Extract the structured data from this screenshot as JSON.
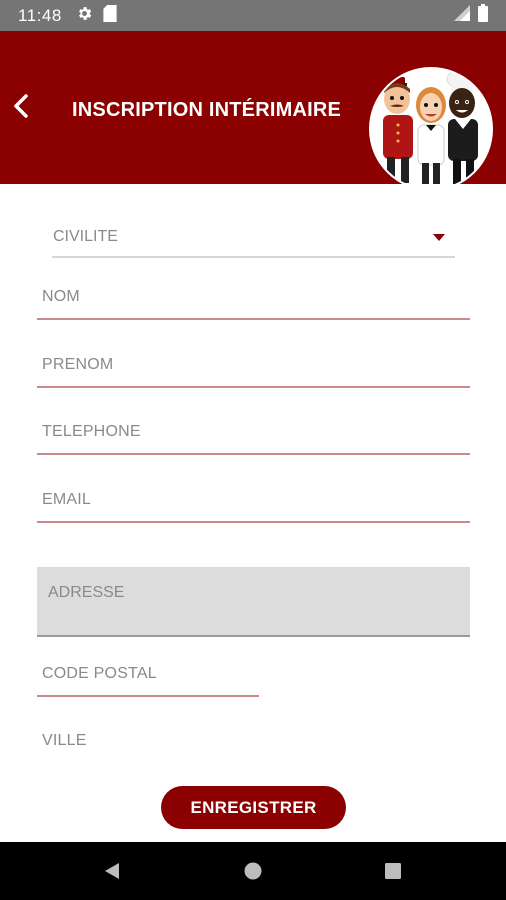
{
  "status_bar": {
    "time": "11:48",
    "icons": [
      "gear-icon",
      "sd-card-icon",
      "signal-icon",
      "battery-icon"
    ]
  },
  "app_bar": {
    "title": "INSCRIPTION INTÉRIMAIRE",
    "back_icon": "chevron-left-icon",
    "image": "mascots-illustration"
  },
  "form": {
    "civilite": {
      "label": "CIVILITE"
    },
    "nom": {
      "label": "NOM"
    },
    "prenom": {
      "label": "PRENOM"
    },
    "telephone": {
      "label": "TELEPHONE"
    },
    "email": {
      "label": "EMAIL"
    },
    "adresse": {
      "label": "ADRESSE"
    },
    "code_postal": {
      "label": "CODE POSTAL"
    },
    "ville": {
      "label": "VILLE"
    },
    "submit_label": "ENREGISTRER"
  },
  "colors": {
    "brand": "#8b0000",
    "status_bar": "#757575",
    "nav_bar": "#000000",
    "placeholder": "#8a8a8a"
  },
  "nav_bar": {
    "icons": [
      "back-triangle-icon",
      "home-circle-icon",
      "recents-square-icon"
    ]
  }
}
